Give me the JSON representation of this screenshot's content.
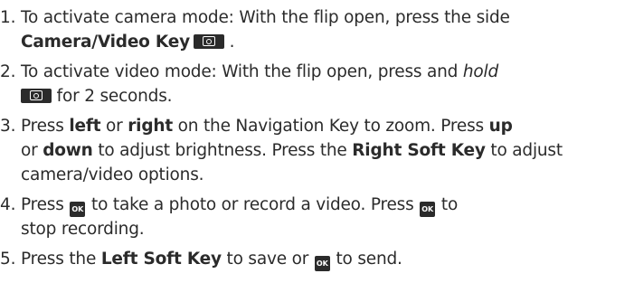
{
  "steps": [
    {
      "number": "1.",
      "lines": [
        {
          "parts": [
            "To activate camera mode: With the flip open, press the side"
          ]
        },
        {
          "parts": [
            "Camera/Video Key",
            " ."
          ]
        }
      ]
    },
    {
      "number": "2.",
      "lines": [
        {
          "parts": [
            "To activate video mode: With the flip open, press and ",
            "hold"
          ]
        },
        {
          "parts": [
            " for 2 seconds."
          ]
        }
      ]
    },
    {
      "number": "3.",
      "lines": [
        {
          "parts": [
            "Press ",
            "left",
            " or ",
            "right",
            " on the Navigation Key to zoom. Press ",
            "up"
          ]
        },
        {
          "parts": [
            "or ",
            "down",
            " to adjust brightness. Press the ",
            "Right Soft Key",
            " to adjust"
          ]
        },
        {
          "parts": [
            "camera/video options."
          ]
        }
      ]
    },
    {
      "number": "4.",
      "lines": [
        {
          "parts": [
            "Press ",
            " to take a photo or record a video. Press ",
            " to"
          ]
        },
        {
          "parts": [
            "stop recording."
          ]
        }
      ]
    },
    {
      "number": "5.",
      "lines": [
        {
          "parts": [
            "Press the ",
            "Left Soft Key",
            " to save or ",
            " to send."
          ]
        }
      ]
    }
  ],
  "icons": {
    "camera_key": "camera-video-key-icon",
    "ok_key": "ok-key-icon",
    "ok_label": "OK"
  }
}
